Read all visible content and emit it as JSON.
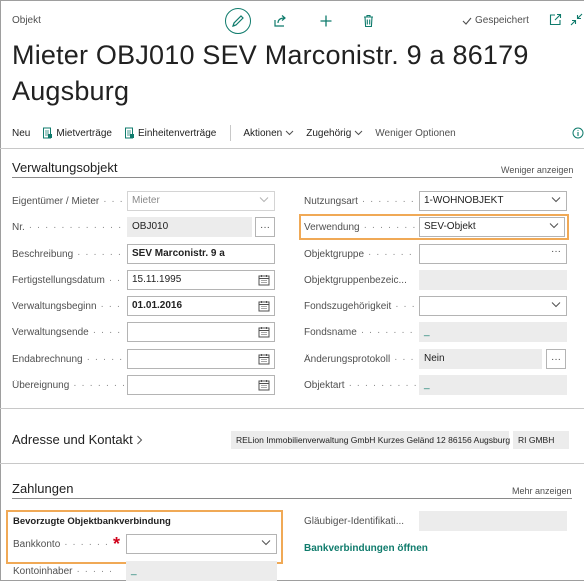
{
  "header": {
    "breadcrumb": "Objekt",
    "saved_label": "Gespeichert",
    "title": "Mieter OBJ010 SEV Marconistr. 9 a 86179 Augsburg"
  },
  "actions": {
    "neu": "Neu",
    "mietvertraege": "Mietverträge",
    "einheitenvertraege": "Einheitenverträge",
    "aktionen": "Aktionen",
    "zugehoerig": "Zugehörig",
    "weniger_optionen": "Weniger Optionen"
  },
  "verwaltungsobjekt": {
    "title": "Verwaltungsobjekt",
    "toggle": "Weniger anzeigen",
    "left": [
      {
        "label": "Eigentümer / Mieter",
        "value": "Mieter"
      },
      {
        "label": "Nr.",
        "value": "OBJ010"
      },
      {
        "label": "Beschreibung",
        "value": "SEV Marconistr. 9 a"
      },
      {
        "label": "Fertigstellungsdatum",
        "value": "15.11.1995"
      },
      {
        "label": "Verwaltungsbeginn",
        "value": "01.01.2016"
      },
      {
        "label": "Verwaltungsende",
        "value": ""
      },
      {
        "label": "Endabrechnung",
        "value": ""
      },
      {
        "label": "Übereignung",
        "value": ""
      }
    ],
    "right": [
      {
        "label": "Nutzungsart",
        "value": "1-WOHNOBJEKT"
      },
      {
        "label": "Verwendung",
        "value": "SEV-Objekt"
      },
      {
        "label": "Objektgruppe",
        "value": ""
      },
      {
        "label": "Objektgruppenbezeic...",
        "value": ""
      },
      {
        "label": "Fondszugehörigkeit",
        "value": ""
      },
      {
        "label": "Fondsname",
        "value": "_"
      },
      {
        "label": "Änderungsprotokoll",
        "value": "Nein"
      },
      {
        "label": "Objektart",
        "value": "_"
      }
    ]
  },
  "adresse": {
    "title": "Adresse und Kontakt",
    "summary": "RELion Immobilienverwaltung GmbH Kurzes Geländ 12 86156 Augsburg",
    "summary2": "RI GMBH"
  },
  "zahlungen": {
    "title": "Zahlungen",
    "toggle": "Mehr anzeigen",
    "group_label": "Bevorzugte Objektbankverbindung",
    "bankkonto_label": "Bankkonto",
    "bankkonto_value": "",
    "kontoinhaber_label": "Kontoinhaber",
    "kontoinhaber_value": "_",
    "glaeubiger_label": "Gläubiger-Identifikati...",
    "glaeubiger_value": "",
    "bank_link": "Bankverbindungen öffnen"
  },
  "colors": {
    "accent": "#0f7b6c",
    "highlight": "#f0a956",
    "required": "#d0021b"
  }
}
